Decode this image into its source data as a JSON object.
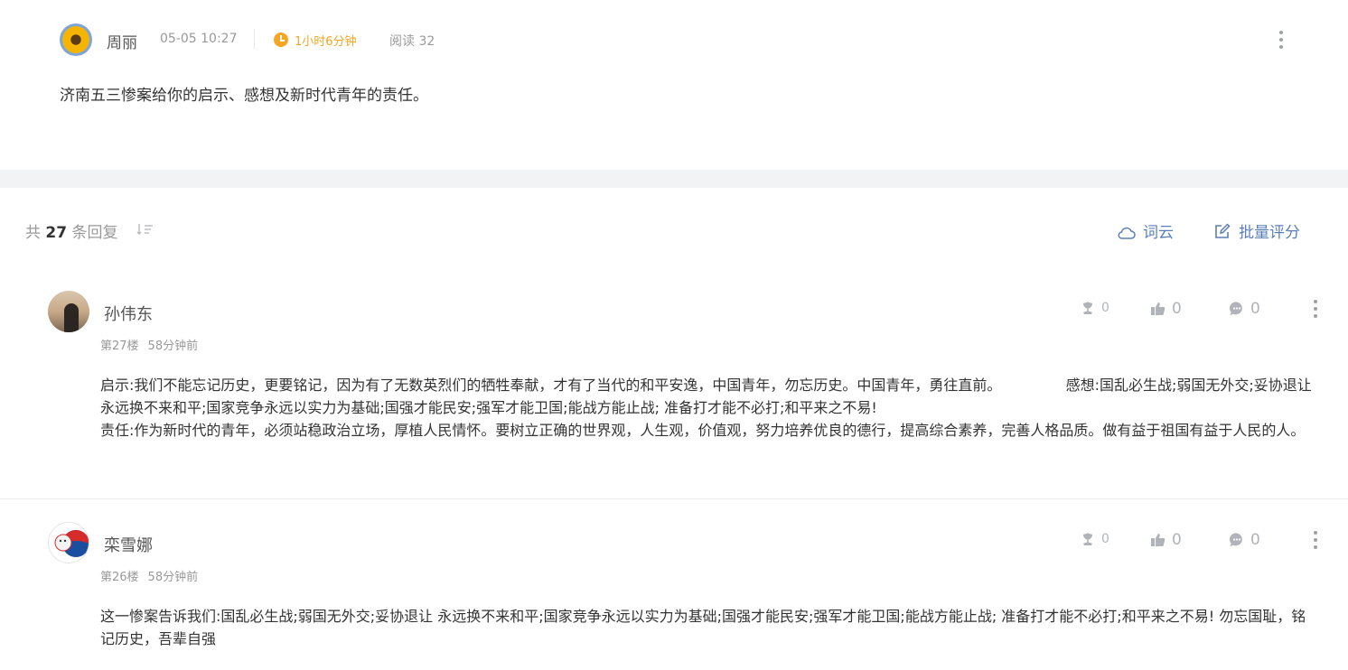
{
  "post": {
    "author": "周丽",
    "time": "05-05 10:27",
    "duration": "1小时6分钟",
    "reads": "阅读 32",
    "title": "济南五三惨案给你的启示、感想及新时代青年的责任。"
  },
  "replies_header": {
    "prefix": "共",
    "count": "27",
    "suffix": "条回复",
    "wordcloud_label": "词云",
    "batch_label": "批量评分"
  },
  "replies": [
    {
      "name": "孙伟东",
      "floor": "第27楼",
      "ago": "58分钟前",
      "flowers": "0",
      "likes": "0",
      "comments": "0",
      "text": "启示:我们不能忘记历史，更要铭记，因为有了无数英烈们的牺牲奉献，才有了当代的和平安逸，中国青年，勿忘历史。中国青年，勇往直前。              感想:国乱必生战;弱国无外交;妥协退让 永远换不来和平;国家竞争永远以实力为基础;国强才能民安;强军才能卫国;能战方能止战; 准备打才能不必打;和平来之不易!\n责任:作为新时代的青年，必须站稳政治立场，厚植人民情怀。要树立正确的世界观，人生观，价值观，努力培养优良的德行，提高综合素养，完善人格品质。做有益于祖国有益于人民的人。"
    },
    {
      "name": "栾雪娜",
      "floor": "第26楼",
      "ago": "58分钟前",
      "flowers": "0",
      "likes": "0",
      "comments": "0",
      "text": "这一惨案告诉我们:国乱必生战;弱国无外交;妥协退让 永远换不来和平;国家竞争永远以实力为基础;国强才能民安;强军才能卫国;能战方能止战; 准备打才能不必打;和平来之不易! 勿忘国耻，铭记历史，吾辈自强"
    }
  ],
  "icons": {
    "post_more": "more-vertical-icon",
    "duration": "clock-icon",
    "sort": "sort-icon",
    "wordcloud": "cloud-icon",
    "batch": "edit-icon",
    "flower": "flower-icon",
    "like": "thumbs-up-icon",
    "comment": "comment-icon"
  },
  "colors": {
    "accent_orange": "#f5a623",
    "link_blue": "#5b7fb8",
    "muted": "#999999",
    "band": "#f2f3f5"
  }
}
